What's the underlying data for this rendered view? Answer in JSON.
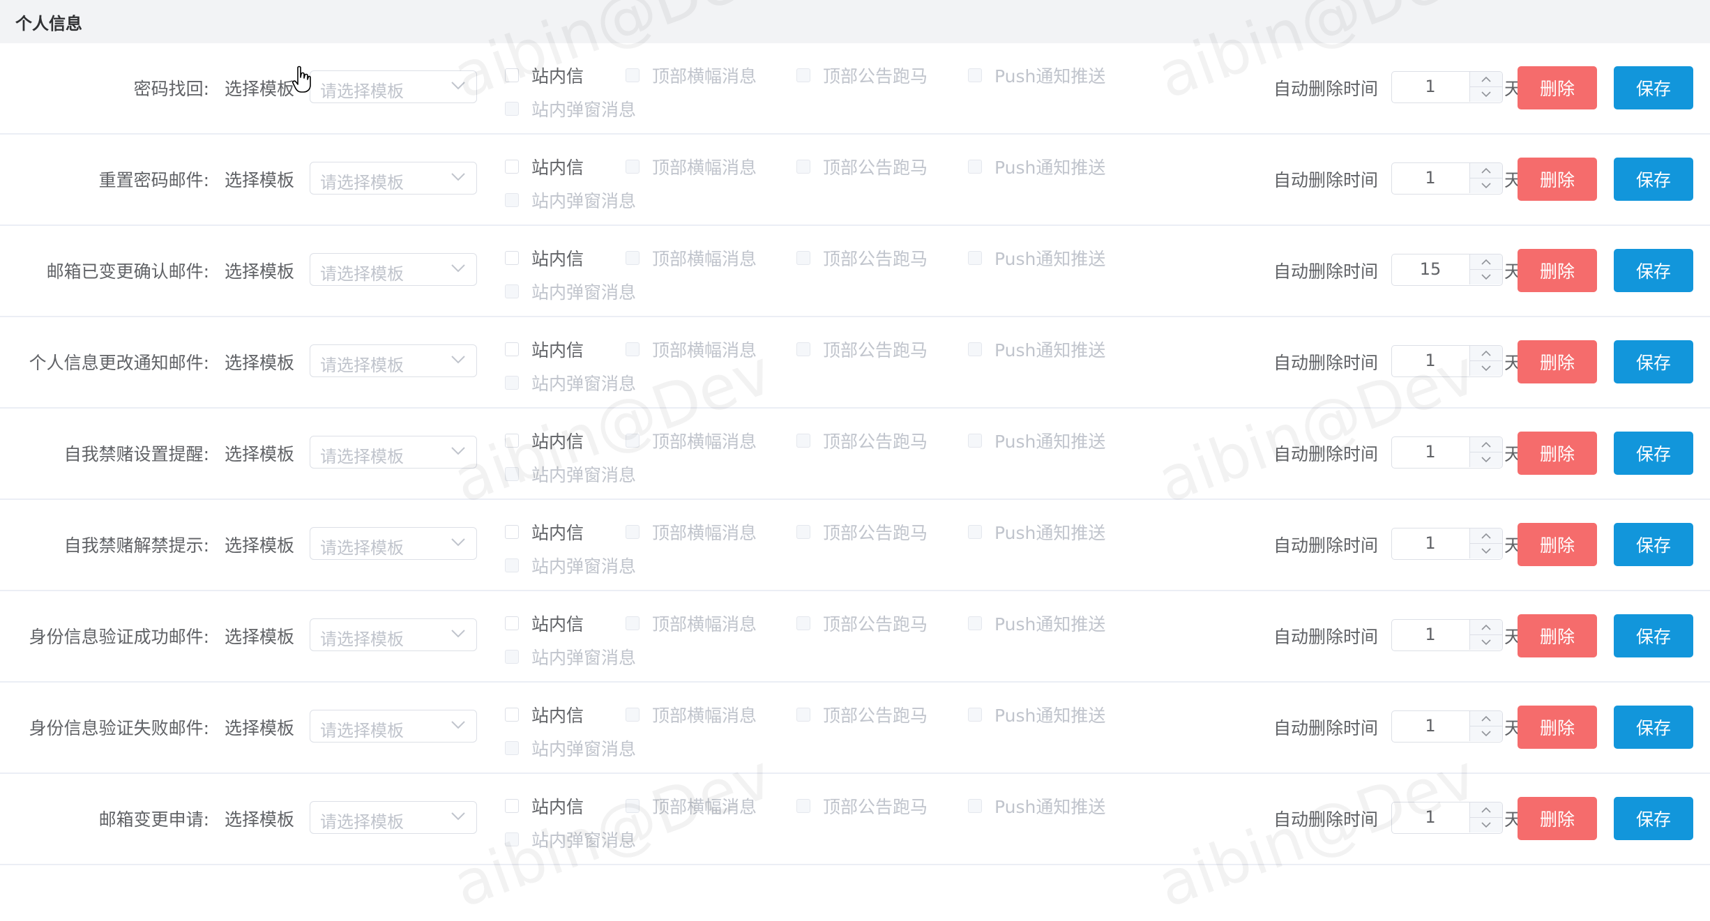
{
  "section": {
    "title": "个人信息"
  },
  "common": {
    "template_label": "选择模板",
    "select_placeholder": "请选择模板",
    "channels": {
      "inbox": "站内信",
      "banner": "顶部横幅消息",
      "marquee": "顶部公告跑马",
      "push": "Push通知推送",
      "popup": "站内弹窗消息"
    },
    "auto_delete_label": "自动删除时间",
    "unit": "天",
    "delete_label": "删除",
    "save_label": "保存"
  },
  "rows": [
    {
      "label": "密码找回:",
      "days": "1"
    },
    {
      "label": "重置密码邮件:",
      "days": "1"
    },
    {
      "label": "邮箱已变更确认邮件:",
      "days": "15"
    },
    {
      "label": "个人信息更改通知邮件:",
      "days": "1"
    },
    {
      "label": "自我禁赌设置提醒:",
      "days": "1"
    },
    {
      "label": "自我禁赌解禁提示:",
      "days": "1"
    },
    {
      "label": "身份信息验证成功邮件:",
      "days": "1"
    },
    {
      "label": "身份信息验证失败邮件:",
      "days": "1"
    },
    {
      "label": "邮箱变更申请:",
      "days": "1"
    }
  ],
  "watermark": "aibin@Dev",
  "colors": {
    "delete": "#f56c6c",
    "save": "#1296db",
    "header_bg": "#f2f3f5"
  },
  "icons": {
    "select_arrow": "chevron-down-icon",
    "stepper_up": "chevron-up-icon",
    "stepper_down": "chevron-down-icon",
    "cursor": "hand-pointer-icon"
  }
}
